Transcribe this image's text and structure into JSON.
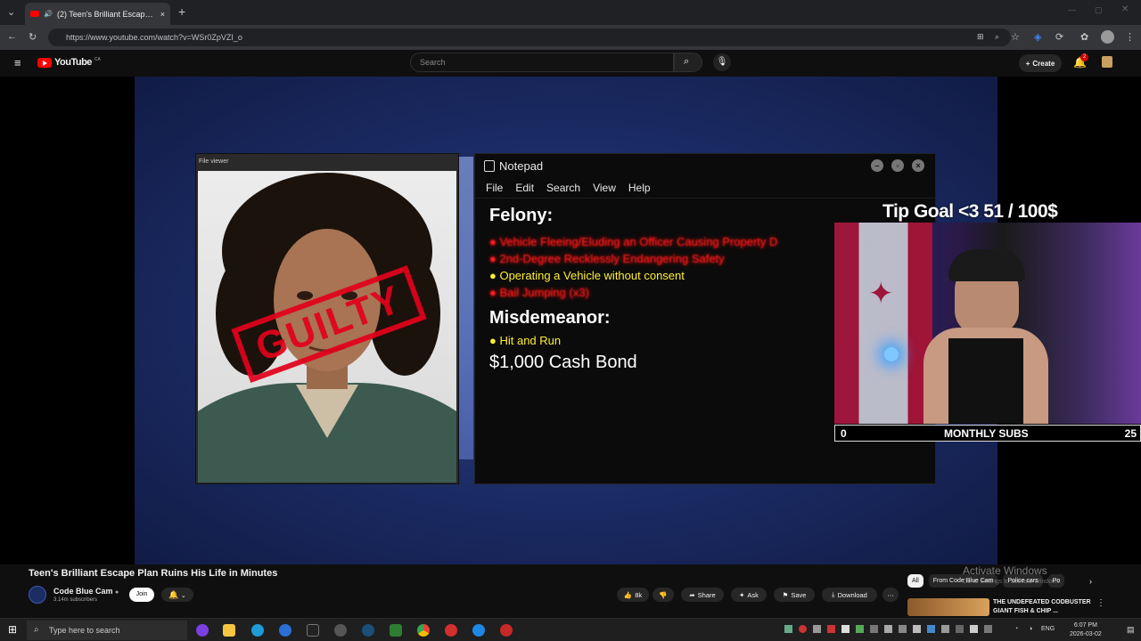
{
  "browser": {
    "tab_title": "(2) Teen's Brilliant Escape Pla",
    "url": "https://www.youtube.com/watch?v=WSr0ZpVZI_o"
  },
  "youtube": {
    "logo_text": "YouTube",
    "region": "CA",
    "search_placeholder": "Search",
    "create_label": "Create",
    "notif_count": "2"
  },
  "video": {
    "file_viewer_title": "File viewer",
    "stamp_text": "GUILTY",
    "notepad": {
      "title": "Notepad",
      "menu": [
        "File",
        "Edit",
        "Search",
        "View",
        "Help"
      ],
      "felony_heading": "Felony:",
      "felony_items": [
        {
          "text": "Vehicle Fleeing/Eluding an Officer Causing Property D",
          "color": "red"
        },
        {
          "text": "2nd-Degree Recklessly Endangering Safety",
          "color": "red"
        },
        {
          "text": "Operating a Vehicle without consent",
          "color": "yellow"
        },
        {
          "text": "Bail Jumping (x3)",
          "color": "red"
        }
      ],
      "misdemeanor_heading": "Misdemeanor:",
      "misdemeanor_items": [
        {
          "text": "Hit and Run",
          "color": "yellow"
        }
      ],
      "bond": "$1,000 Cash Bond"
    },
    "tip_goal": "Tip Goal  <3  51 / 100$",
    "subs_bar": {
      "left": "0",
      "label": "MONTHLY SUBS",
      "right": "25"
    }
  },
  "below": {
    "title": "Teen's Brilliant Escape Plan Ruins His Life in Minutes",
    "channel": "Code Blue Cam",
    "subscribers": "3.14m subscribers",
    "join": "Join",
    "likes": "8k",
    "share": "Share",
    "ask": "Ask",
    "save": "Save",
    "download": "Download",
    "chips": [
      "All",
      "From Code Blue Cam",
      "Police cars",
      "Po"
    ],
    "activate_title": "Activate Windows",
    "activate_sub": "Go to Settings to activate Windows.",
    "rec_title": "THE UNDEFEATED CODBUSTER GIANT FISH & CHIP ..."
  },
  "taskbar": {
    "search_placeholder": "Type here to search",
    "lang": "ENG",
    "time": "6:07 PM",
    "date": "2026-03-02"
  }
}
